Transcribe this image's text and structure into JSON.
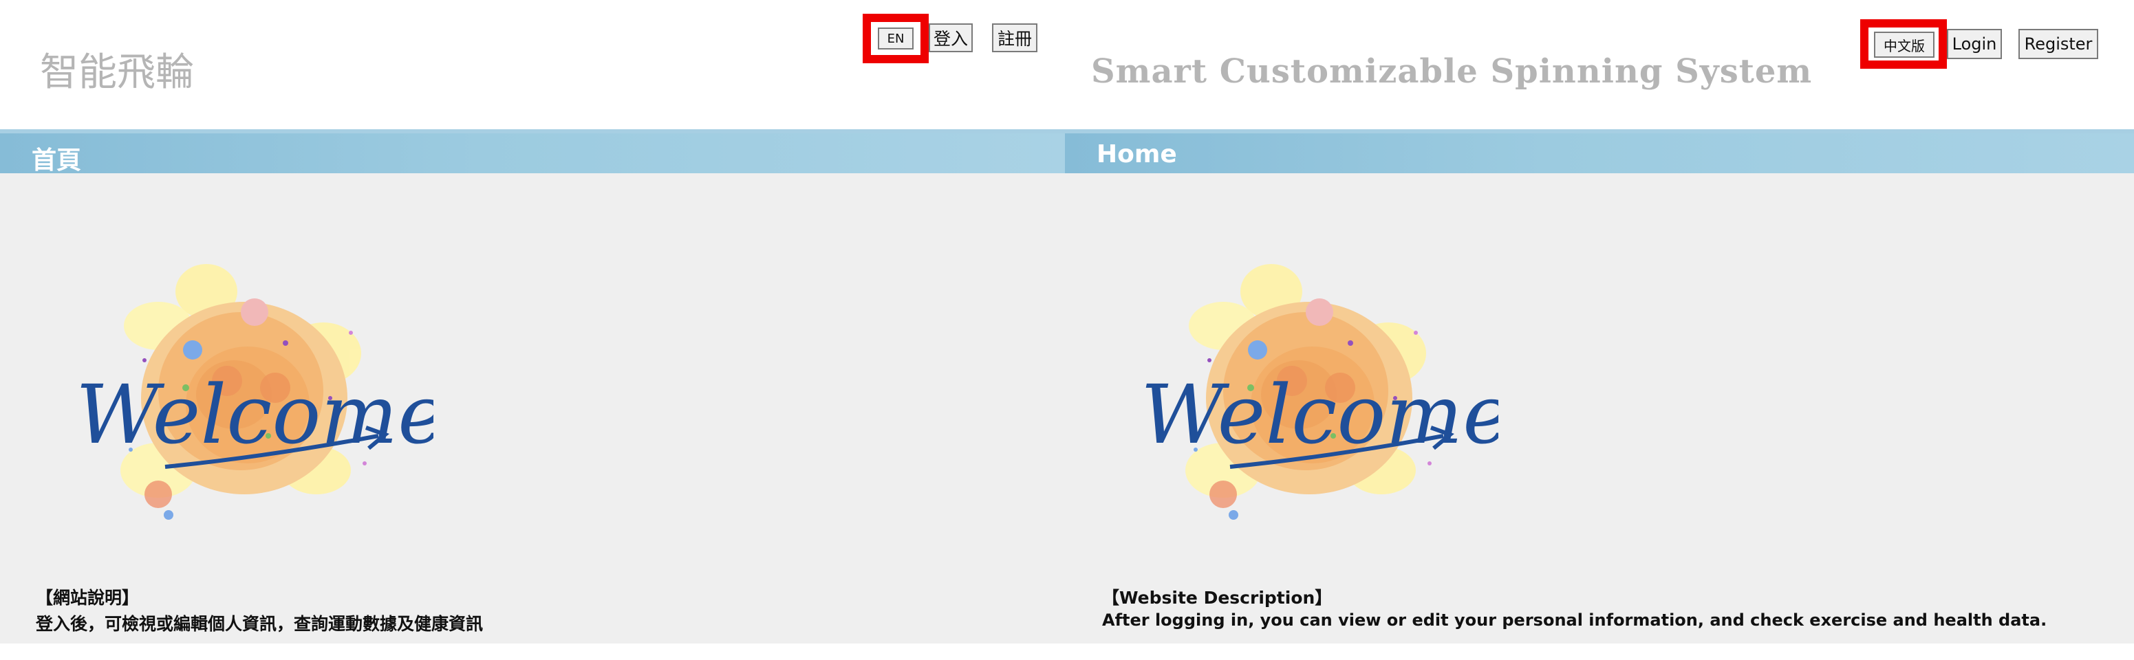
{
  "zh": {
    "site_title": "智能飛輪",
    "lang_button": "EN",
    "login_button": "登入",
    "register_button": "註冊",
    "home_label": "首頁",
    "welcome_text": "Welcome",
    "description_title": "【網站說明】",
    "description_text": "登入後，可檢視或編輯個人資訊，查詢運動數據及健康資訊"
  },
  "en": {
    "site_title": "Smart Customizable Spinning System",
    "lang_button": "中文版",
    "login_button": "Login",
    "register_button": "Register",
    "home_label": "Home",
    "welcome_text": "Welcome",
    "description_title": "【Website Description】",
    "description_text": "After logging in, you can view or edit your personal information, and check exercise and health data."
  },
  "colors": {
    "highlight": "#ee0000",
    "header_bar": "#9ccbe0",
    "content_bg": "#efefef",
    "title_gray": "#b5b5b5",
    "welcome_blue": "#1f4f9a"
  }
}
